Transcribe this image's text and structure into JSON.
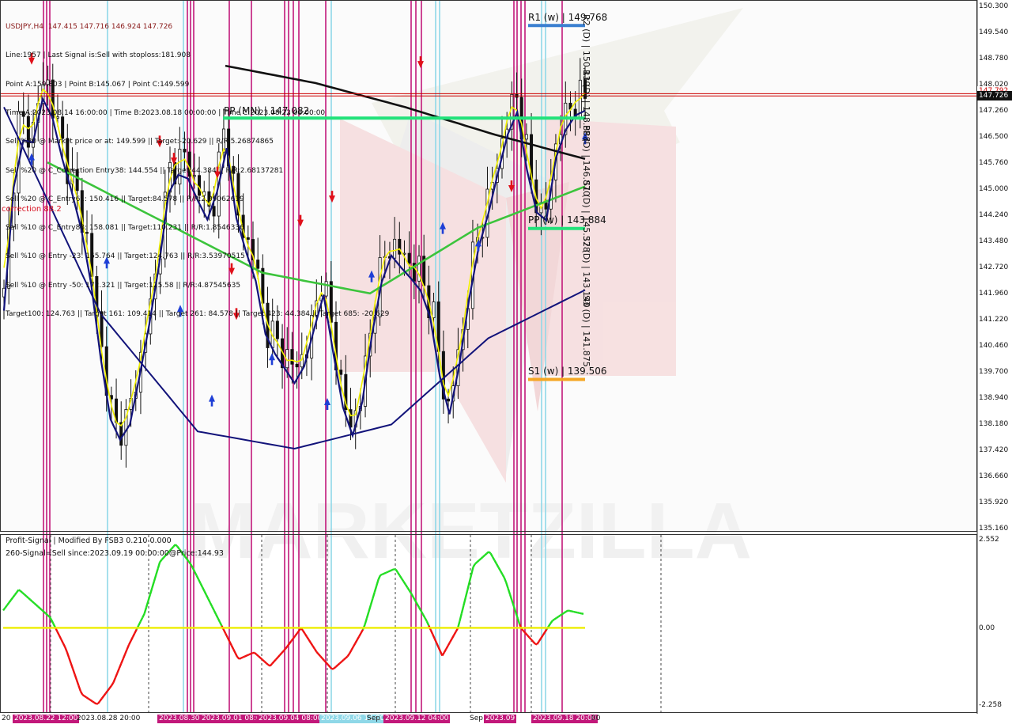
{
  "header": {
    "symbol_line": "USDJPY,H4  147.415 147.716 146.924 147.726",
    "lines": [
      "Line:1957 | Last Signal is:Sell with stoploss:181.908",
      "Point A:159.803 | Point B:145.067 | Point C:149.599",
      "Time A:2023.08.14 16:00:00 | Time B:2023.08.18 00:00:00 | Time C:2023.08.22 08:00:00",
      "Sell %20 @ Market price or at: 149.599 || Target:-20.629 || R/R:5.26874865",
      "Sell %20 @ C_Correction Entry38: 144.554 || Target:44.384 || R/R:2.68137281",
      "Sell %20 @ C_Entry61: 150.416 || Target:84.578 || R/R:2.09062619",
      "Sell %10 @ C_Entry88: 158.081 || Target:110.231 || R/R:1.8546336",
      "Sell %10 @ Entry -23: 165.764 || Target:124.763 || R/R:3.53970515",
      "Sell %10 @ Entry -50: 172.321 || Target:125.58 || R/R:4.87545635",
      "Target100: 124.763 || Target 161: 109.414 || Target 261: 84.578 || Target 423: 44.384 || Target 685: -20.629"
    ],
    "correction_label": "correction 88.2"
  },
  "levels": {
    "r1_weekly": "R1 (w) | 149.768",
    "pp_monthly": "PP (MN) | 147.082",
    "pp_weekly": "PP (w) | 143.884",
    "s1_weekly": "S1 (w) | 139.506",
    "vertical_daily": [
      "R2 (D) | 150.139",
      "R1 (D) | 148.888",
      "PP (D) | 146.870",
      "S1 (D) | 145.378",
      "S2 (D) | 143.140",
      "S3 (D) | 141.875"
    ]
  },
  "price_axis": {
    "ticks": [
      "150.300",
      "149.540",
      "148.780",
      "148.020",
      "147.260",
      "146.500",
      "145.760",
      "145.000",
      "144.240",
      "143.480",
      "142.720",
      "141.960",
      "141.220",
      "140.460",
      "139.700",
      "138.940",
      "138.180",
      "137.420",
      "136.660",
      "135.920",
      "135.160"
    ],
    "current_price": "147.726",
    "upper_price": "147.792"
  },
  "indicator": {
    "title": "Profit-Signal | Modified By FSB3 0.210 0.000",
    "signal_text": "260-Signal=Sell since:2023.09.19 00:00:00@Price:144.93",
    "ticks": [
      "2.552",
      "0.00",
      "-2.258"
    ]
  },
  "time_axis": {
    "labels": [
      "20",
      "2023.08.22 12:00",
      "2023.08.28 20:00",
      "2023.08.30",
      "2023.09.01 08:00",
      "2023.09.04 08:00",
      "2023.09.06 12:00",
      "Sep 0",
      "2023.09.12 04:00",
      "Sep",
      "2023.09",
      "2023.09.18 20:00",
      "00"
    ]
  },
  "colors": {
    "bull_up": "#1f3fd6",
    "bear_down": "#e0101a",
    "magenta": "#c2187a",
    "cyan": "#8fd8e8",
    "yellow": "#f2f200",
    "green_ma": "#3cc43c",
    "navy_ma": "#12137a",
    "black_ma": "#111111",
    "pp_green": "#22e27a",
    "r1_blue": "#3a7fd0",
    "s1_orange": "#f5a623",
    "price_red": "#cc0000"
  },
  "chart_data": [
    {
      "type": "candlestick",
      "title": "USDJPY,H4",
      "ylim": [
        135.16,
        150.3
      ],
      "grid": false,
      "close_series": [
        141.9,
        147.0,
        146.6,
        148.4,
        146.6,
        145.2,
        143.6,
        140.5,
        138.0,
        138.4,
        140.4,
        142.6,
        145.6,
        146.0,
        145.1,
        144.3,
        146.9,
        144.0,
        143.2,
        141.0,
        140.4,
        139.8,
        140.5,
        142.6,
        140.2,
        138.0,
        139.4,
        142.4,
        143.5,
        143.0,
        142.6,
        141.5,
        138.5,
        140.5,
        143.3,
        144.7,
        146.4,
        147.9,
        145.5,
        144.0,
        146.6,
        147.5,
        147.7
      ],
      "moving_averages": [
        {
          "name": "black",
          "values": [
            148.6,
            148.1,
            147.4,
            146.6,
            145.9
          ]
        },
        {
          "name": "green",
          "values": [
            145.8,
            144.2,
            142.6,
            142.0,
            143.9,
            145.1
          ]
        },
        {
          "name": "navy",
          "values": [
            147.4,
            141.4,
            138.0,
            137.5,
            138.2,
            140.7,
            142.1
          ]
        }
      ],
      "signals": {
        "down": [
          148.7,
          146.3,
          145.8,
          145.4,
          142.6,
          141.3,
          144.0,
          144.7,
          148.6,
          145.0
        ],
        "up": [
          146.0,
          143.0,
          141.6,
          139.0,
          140.2,
          138.9,
          142.6,
          144.0,
          143.5,
          146.6
        ]
      }
    },
    {
      "type": "line",
      "title": "Profit-Signal",
      "ylim": [
        -2.258,
        2.552
      ],
      "series": [
        {
          "values": [
            0.5,
            1.1,
            0.7,
            0.3,
            -0.6,
            -1.9,
            -2.2,
            -1.6,
            -0.5,
            0.4,
            1.9,
            2.4,
            1.8,
            0.9,
            0.0,
            -0.9,
            -0.7,
            -1.1,
            -0.6,
            0.0,
            -0.7,
            -1.2,
            -0.8,
            0.0,
            1.5,
            1.7,
            1.0,
            0.2,
            -0.8,
            0.0,
            1.8,
            2.2,
            1.4,
            0.0,
            -0.5,
            0.2,
            0.5,
            0.4
          ]
        },
        {
          "values": [
            0,
            0
          ]
        }
      ]
    }
  ]
}
